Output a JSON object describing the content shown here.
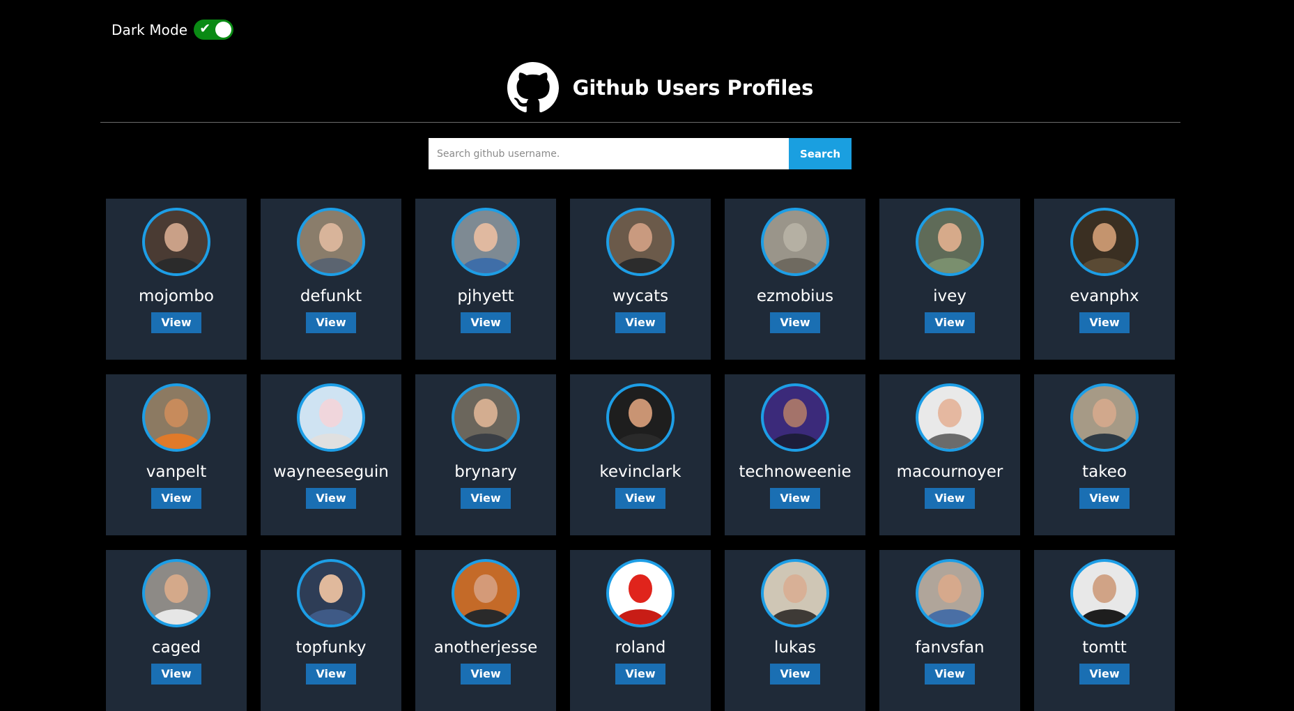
{
  "dark_mode": {
    "label": "Dark Mode",
    "enabled": true,
    "check_glyph": "✔"
  },
  "header": {
    "title": "Github Users Profiles",
    "logo_icon": "github-octocat-icon"
  },
  "search": {
    "placeholder": "Search github username.",
    "value": "",
    "button_label": "Search"
  },
  "colors": {
    "background": "#000000",
    "card_bg": "#1f2a38",
    "avatar_ring": "#1d9ee6",
    "view_button": "#1a6fb3",
    "search_button": "#1a9fe0",
    "toggle_on": "#0a8a14"
  },
  "users": [
    {
      "username": "mojombo",
      "view_label": "View",
      "avatar_bg": "#4a3b33",
      "face": "#c9a087",
      "shirt": "#2b2b2b"
    },
    {
      "username": "defunkt",
      "view_label": "View",
      "avatar_bg": "#8a7d6b",
      "face": "#d8b49a",
      "shirt": "#5b6470"
    },
    {
      "username": "pjhyett",
      "view_label": "View",
      "avatar_bg": "#7e8a93",
      "face": "#e0b9a0",
      "shirt": "#3f6ea8"
    },
    {
      "username": "wycats",
      "view_label": "View",
      "avatar_bg": "#6b5a4a",
      "face": "#c99a7f",
      "shirt": "#2c2c2c"
    },
    {
      "username": "ezmobius",
      "view_label": "View",
      "avatar_bg": "#9a958a",
      "face": "#b5b0a3",
      "shirt": "#6f6a60"
    },
    {
      "username": "ivey",
      "view_label": "View",
      "avatar_bg": "#5f6b58",
      "face": "#d6aa8a",
      "shirt": "#7a8f6e"
    },
    {
      "username": "evanphx",
      "view_label": "View",
      "avatar_bg": "#3a2f22",
      "face": "#c4946e",
      "shirt": "#5a4a34"
    },
    {
      "username": "vanpelt",
      "view_label": "View",
      "avatar_bg": "#8c7a62",
      "face": "#c78b5c",
      "shirt": "#e07a2a"
    },
    {
      "username": "wayneeseguin",
      "view_label": "View",
      "avatar_bg": "#cfe3f2",
      "face": "#f0d6dc",
      "shirt": "#e0e0e0"
    },
    {
      "username": "brynary",
      "view_label": "View",
      "avatar_bg": "#6b665c",
      "face": "#d3ad90",
      "shirt": "#3b3f45"
    },
    {
      "username": "kevinclark",
      "view_label": "View",
      "avatar_bg": "#1e1e1e",
      "face": "#c99473",
      "shirt": "#2a2a2a"
    },
    {
      "username": "technoweenie",
      "view_label": "View",
      "avatar_bg": "#3b2a7a",
      "face": "#a4736a",
      "shirt": "#1d1d3a"
    },
    {
      "username": "macournoyer",
      "view_label": "View",
      "avatar_bg": "#e9e9e9",
      "face": "#e5b8a0",
      "shirt": "#6b6b6b"
    },
    {
      "username": "takeo",
      "view_label": "View",
      "avatar_bg": "#a69a86",
      "face": "#d1a88c",
      "shirt": "#2f3a44"
    },
    {
      "username": "caged",
      "view_label": "View",
      "avatar_bg": "#8d8a86",
      "face": "#d4a98a",
      "shirt": "#e6e6e6"
    },
    {
      "username": "topfunky",
      "view_label": "View",
      "avatar_bg": "#2e3d56",
      "face": "#e0b99c",
      "shirt": "#3f5a86"
    },
    {
      "username": "anotherjesse",
      "view_label": "View",
      "avatar_bg": "#c46a28",
      "face": "#d49a78",
      "shirt": "#2a2a2a"
    },
    {
      "username": "roland",
      "view_label": "View",
      "avatar_bg": "#ffffff",
      "face": "#e0241c",
      "shirt": "#c81d16"
    },
    {
      "username": "lukas",
      "view_label": "View",
      "avatar_bg": "#cfc6b5",
      "face": "#d8b096",
      "shirt": "#3e3a36"
    },
    {
      "username": "fanvsfan",
      "view_label": "View",
      "avatar_bg": "#b0a59a",
      "face": "#d6a98c",
      "shirt": "#4a6fa5"
    },
    {
      "username": "tomtt",
      "view_label": "View",
      "avatar_bg": "#e8e8e8",
      "face": "#d0a386",
      "shirt": "#1e1e1e"
    }
  ]
}
